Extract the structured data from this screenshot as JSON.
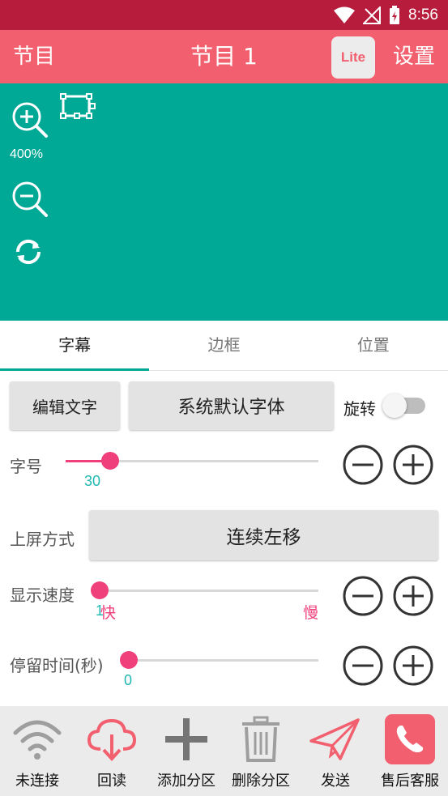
{
  "status": {
    "time": "8:56"
  },
  "app_bar": {
    "left_label": "节目",
    "title": "节目 1",
    "lite_label": "Lite",
    "right_label": "设置"
  },
  "canvas": {
    "zoom_level": "400%",
    "background": "#00a896"
  },
  "tabs": [
    {
      "label": "字幕",
      "active": true
    },
    {
      "label": "边框",
      "active": false
    },
    {
      "label": "位置",
      "active": false
    }
  ],
  "controls": {
    "edit_text_label": "编辑文字",
    "font_label": "系统默认字体",
    "rotate_label": "旋转",
    "rotate_on": false,
    "font_size": {
      "label": "字号",
      "value": "30",
      "fraction": 0.1
    },
    "screen_mode": {
      "label": "上屏方式",
      "value": "连续左移"
    },
    "speed": {
      "label": "显示速度",
      "value": "1",
      "fast_label": "快",
      "slow_label": "慢",
      "fraction": 0.0
    },
    "pause": {
      "label": "停留时间(秒)",
      "value": "0",
      "fraction": 0.0
    }
  },
  "bottom_nav": [
    {
      "label": "未连接",
      "icon": "wifi-icon"
    },
    {
      "label": "回读",
      "icon": "cloud-download-icon"
    },
    {
      "label": "添加分区",
      "icon": "plus-icon"
    },
    {
      "label": "删除分区",
      "icon": "trash-icon"
    },
    {
      "label": "发送",
      "icon": "send-icon"
    },
    {
      "label": "售后客服",
      "icon": "phone-icon"
    }
  ],
  "colors": {
    "accent": "#f2606f",
    "status_bar": "#b71c3c",
    "teal": "#00a896",
    "slider": "#f0407c"
  }
}
